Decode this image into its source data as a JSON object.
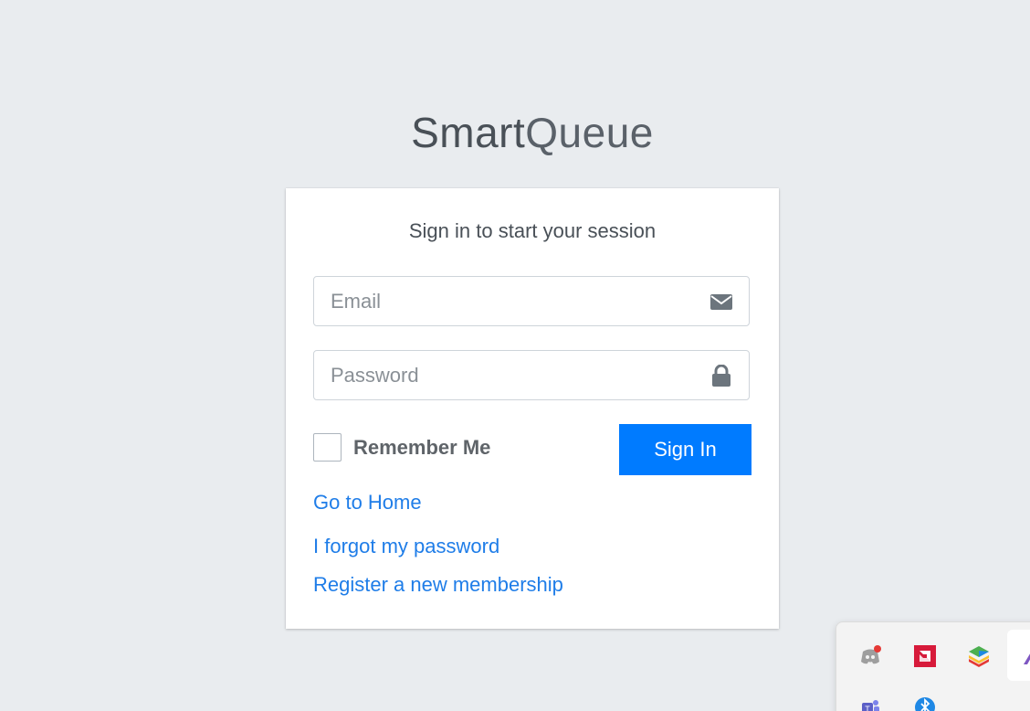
{
  "logo": {
    "bold": "Smart",
    "light": "Queue"
  },
  "login": {
    "message": "Sign in to start your session",
    "email_placeholder": "Email",
    "email_icon": "envelope-icon",
    "password_placeholder": "Password",
    "password_icon": "lock-icon",
    "remember_label": "Remember Me",
    "remember_checked": false,
    "signin_label": "Sign In"
  },
  "links": {
    "home": "Go to Home",
    "forgot": "I forgot my password",
    "register": "Register a new membership"
  },
  "colors": {
    "background": "#e9ecef",
    "primary": "#007bff",
    "link": "#1f7de8"
  },
  "tray": {
    "icons": [
      "discord-icon",
      "amd-icon",
      "bluestacks-icon",
      "pen-icon",
      "teams-icon",
      "bluetooth-icon"
    ]
  }
}
